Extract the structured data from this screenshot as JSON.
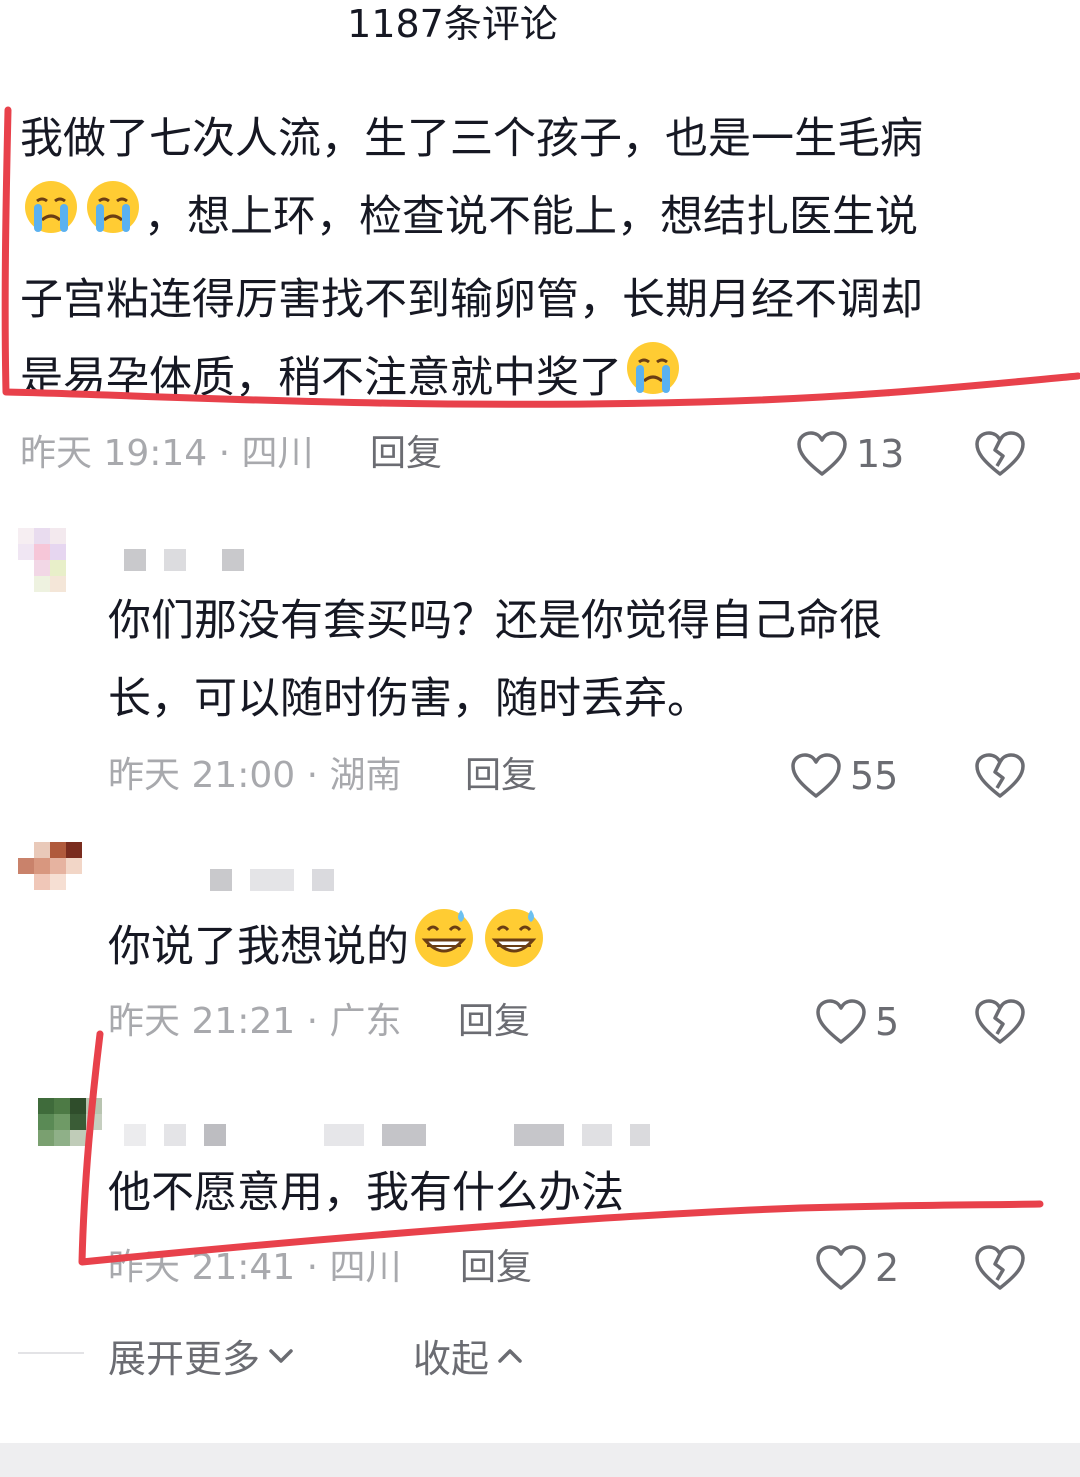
{
  "header": {
    "title": "1187条评论"
  },
  "comments": [
    {
      "lines": [
        "我做了七次人流，生了三个孩子，也是一生毛病",
        "，想上环，检查说不能上，想结扎医生说",
        "子宫粘连得厉害找不到输卵管，长期月经不调却",
        "是易孕体质，稍不注意就中奖了"
      ],
      "time": "昨天 19:14 · 四川",
      "reply_label": "回复",
      "likes": "13"
    },
    {
      "lines": [
        "你们那没有套买吗？还是你觉得自己命很",
        "长，可以随时伤害，随时丢弃。"
      ],
      "time": "昨天 21:00 · 湖南",
      "reply_label": "回复",
      "likes": "55"
    },
    {
      "lines": [
        "你说了我想说的"
      ],
      "time": "昨天 21:21 · 广东",
      "reply_label": "回复",
      "likes": "5"
    },
    {
      "lines": [
        "他不愿意用，我有什么办法"
      ],
      "time": "昨天 21:41 · 四川",
      "reply_label": "回复",
      "likes": "2"
    }
  ],
  "footer": {
    "expand_more": "展开更多",
    "collapse": "收起"
  },
  "icons": {
    "like": "heart-outline-icon",
    "dislike": "broken-heart-icon",
    "expand": "chevron-down-icon",
    "collapse": "chevron-up-icon",
    "emoji_cry": "loudly-crying-face-emoji",
    "emoji_grin": "grinning-sweat-face-emoji"
  },
  "colors": {
    "text": "#161823",
    "meta": "#a8a9ad",
    "action": "#6b6c72",
    "annotation": "#e8414b"
  }
}
